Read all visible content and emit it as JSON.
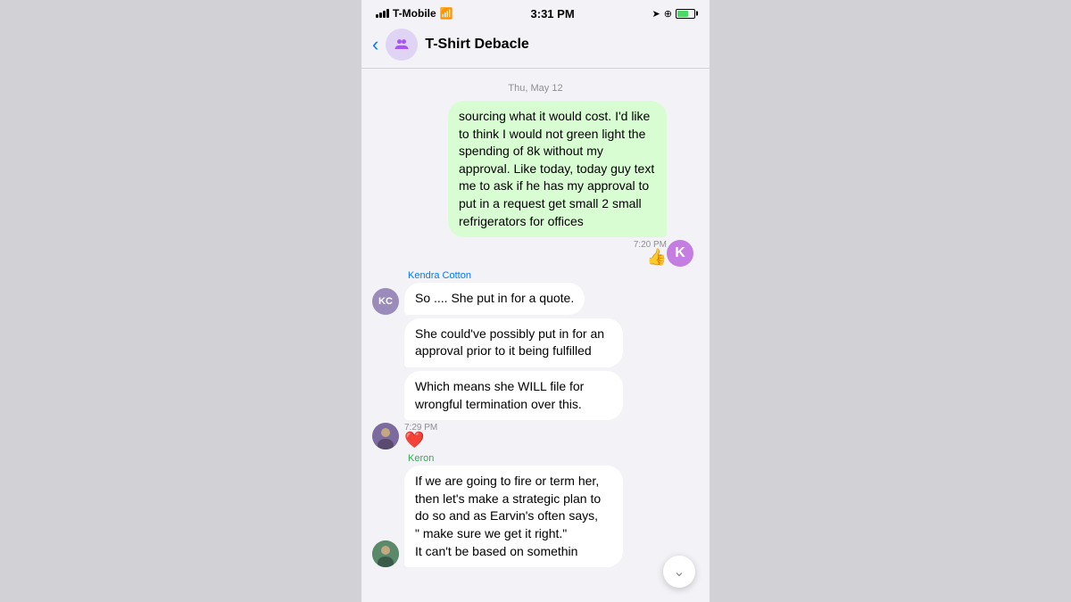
{
  "status_bar": {
    "carrier": "T-Mobile",
    "time": "3:31 PM"
  },
  "nav": {
    "title": "T-Shirt Debacle",
    "back_label": "‹"
  },
  "date_divider": "Thu, May 12",
  "messages": [
    {
      "id": "msg1",
      "type": "outgoing",
      "avatar_letter": "K",
      "text": "sourcing what it would cost. I'd like to think I would not green light the spending of 8k without my approval. Like today, today guy text me to ask if he has my approval to put in a request  get small 2 small refrigerators for offices",
      "time": "7:20 PM",
      "reaction": "👍"
    },
    {
      "id": "msg2",
      "type": "incoming",
      "sender": "Kendra Cotton",
      "sender_color": "kendra",
      "text": "So .... She put in for a quote.",
      "time": null
    },
    {
      "id": "msg3",
      "type": "incoming",
      "sender": null,
      "text": "She could've possibly put in for an approval prior to it being fulfilled",
      "time": null
    },
    {
      "id": "msg4",
      "type": "incoming",
      "sender": null,
      "text": "Which means she WILL file for wrongful termination over this.",
      "time": "7:29 PM",
      "reaction": "❤️"
    },
    {
      "id": "msg5",
      "type": "incoming",
      "sender": "Keron",
      "sender_color": "keron",
      "text": "If we are going to fire or term her, then let's make a strategic plan to do so and as Earvin's often says,\n\" make sure we get it right.\"\nIt can't be based on somethin",
      "time": null
    }
  ]
}
